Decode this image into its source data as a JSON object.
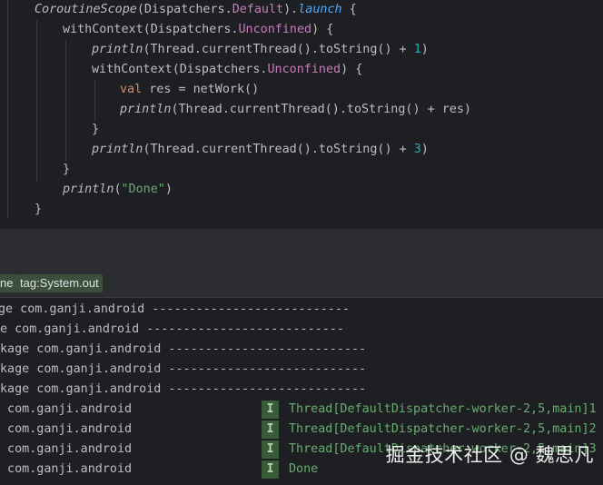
{
  "code": {
    "l1": {
      "a": "CoroutineScope",
      "b": "(Dispatchers.",
      "c": "Default",
      "d": ").",
      "e": "launch",
      "f": " {"
    },
    "l2": {
      "a": "withContext",
      "b": "(Dispatchers.",
      "c": "Unconfined",
      "d": ") {"
    },
    "l3": {
      "a": "println",
      "b": "(Thread.currentThread().toString() + ",
      "c": "1",
      "d": ")"
    },
    "l4": {
      "a": "withContext",
      "b": "(Dispatchers.",
      "c": "Unconfined",
      "d": ") {"
    },
    "l5": {
      "a": "val",
      "b": " res = netWork()"
    },
    "l6": {
      "a": "println",
      "b": "(Thread.currentThread().toString() + res)"
    },
    "l7": {
      "a": "}"
    },
    "l8": {
      "a": "println",
      "b": "(Thread.currentThread().toString() + ",
      "c": "3",
      "d": ")"
    },
    "l9": {
      "a": "}"
    },
    "l10": {
      "a": "println",
      "b": "(",
      "c": "\"Done\"",
      "d": ")"
    },
    "l11": {
      "a": "}"
    }
  },
  "filter": {
    "chip1": "ne",
    "chip2": "tag:System.out"
  },
  "log": {
    "rows": [
      {
        "text": "ge com.ganji.android ---------------------------"
      },
      {
        "text": "e com.ganji.android ---------------------------"
      },
      {
        "text": "kage com.ganji.android ---------------------------"
      },
      {
        "text": "kage com.ganji.android ---------------------------"
      },
      {
        "text": "kage com.ganji.android ---------------------------"
      },
      {
        "text": " com.ganji.android",
        "level": "I",
        "msg": "Thread[DefaultDispatcher-worker-2,5,main]1"
      },
      {
        "text": " com.ganji.android",
        "level": "I",
        "msg": "Thread[DefaultDispatcher-worker-2,5,main]2"
      },
      {
        "text": " com.ganji.android",
        "level": "I",
        "msg": "Thread[DefaultDispatcher-worker-2,5,main]3"
      },
      {
        "text": " com.ganji.android",
        "level": "I",
        "msg": "Done"
      }
    ]
  },
  "watermark": "掘金技术社区 @ 魏思凡"
}
